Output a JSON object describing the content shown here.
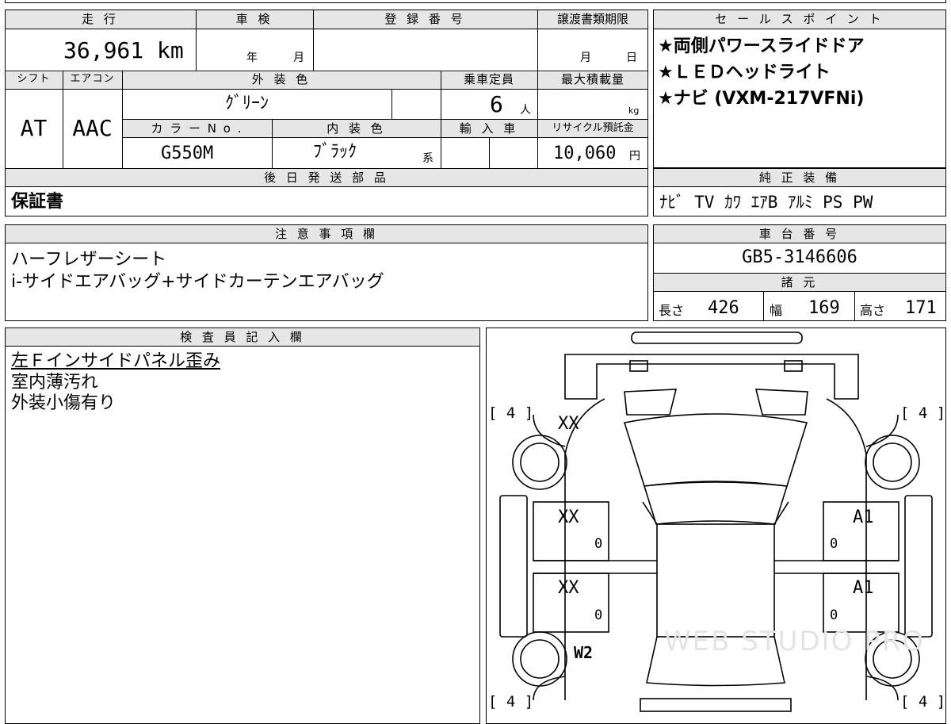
{
  "basic": {
    "mileage_label": "走 行",
    "mileage_value": "36,961 km",
    "inspection_label": "車 検",
    "inspection_year_unit": "年",
    "inspection_month_unit": "月",
    "registration_label": "登 録 番 号",
    "transfer_deadline_label": "譲渡書類期限",
    "transfer_month_unit": "月",
    "transfer_day_unit": "日",
    "shift_label": "シフト",
    "shift_value": "AT",
    "aircon_label": "エアコン",
    "aircon_value": "AAC",
    "exterior_color_label": "外 装 色",
    "exterior_color_value": "ｸﾞﾘｰﾝ",
    "capacity_label": "乗車定員",
    "capacity_value": "6",
    "capacity_unit": "人",
    "max_load_label": "最大積載量",
    "max_load_unit": "kg",
    "color_no_label": "カ ラ ー N o .",
    "color_no_value": "G550M",
    "interior_color_label": "内 装 色",
    "interior_color_value": "ﾌﾞﾗｯｸ",
    "interior_color_suffix": "系",
    "import_label": "輸 入 車",
    "recycle_label": "リサイクル預託金",
    "recycle_value": "10,060",
    "recycle_unit": "円",
    "later_parts_label": "後 日 発 送 部 品",
    "later_parts_value": "保証書"
  },
  "sales_points": {
    "label": "セ ー ル ス ポ イ ン ト",
    "items": [
      "★両側パワースライドドア",
      "★ＬＥＤヘッドライト",
      "★ナビ (VXM-217VFNi)"
    ]
  },
  "equipment": {
    "label": "純 正 装 備",
    "value": "ﾅﾋﾞ TV ｶﾜ ｴｱB ｱﾙﾐ PS PW"
  },
  "notes": {
    "label": "注 意 事 項 欄",
    "lines": [
      "ハーフレザーシート",
      "i-サイドエアバッグ+サイドカーテンエアバッグ"
    ]
  },
  "chassis": {
    "label": "車 台 番 号",
    "value": "GB5-3146606"
  },
  "specs": {
    "label": "諸 元",
    "length_label": "長さ",
    "length_value": "426",
    "width_label": "幅",
    "width_value": "169",
    "height_label": "高さ",
    "height_value": "171"
  },
  "inspector": {
    "label": "検 査 員 記 入 欄",
    "lines": [
      "左Ｆインサイドパネル歪み",
      "室内薄汚れ",
      "外装小傷有り"
    ]
  },
  "diagram": {
    "tire_tl": "[ 4 ]",
    "tire_tr": "[ 4 ]",
    "tire_bl": "[ 4 ]",
    "tire_br": "[ 4 ]",
    "front_left_fender": "XX",
    "left_front_door": "XX",
    "left_front_door_num": "0",
    "left_rear_door": "XX",
    "left_rear_door_num": "0",
    "left_rear_quarter": "W2",
    "right_front_door": "A1",
    "right_front_door_num": "0",
    "right_rear_door": "A1",
    "right_rear_door_num": "0",
    "watermark": "WEB STUDIO PRO"
  }
}
